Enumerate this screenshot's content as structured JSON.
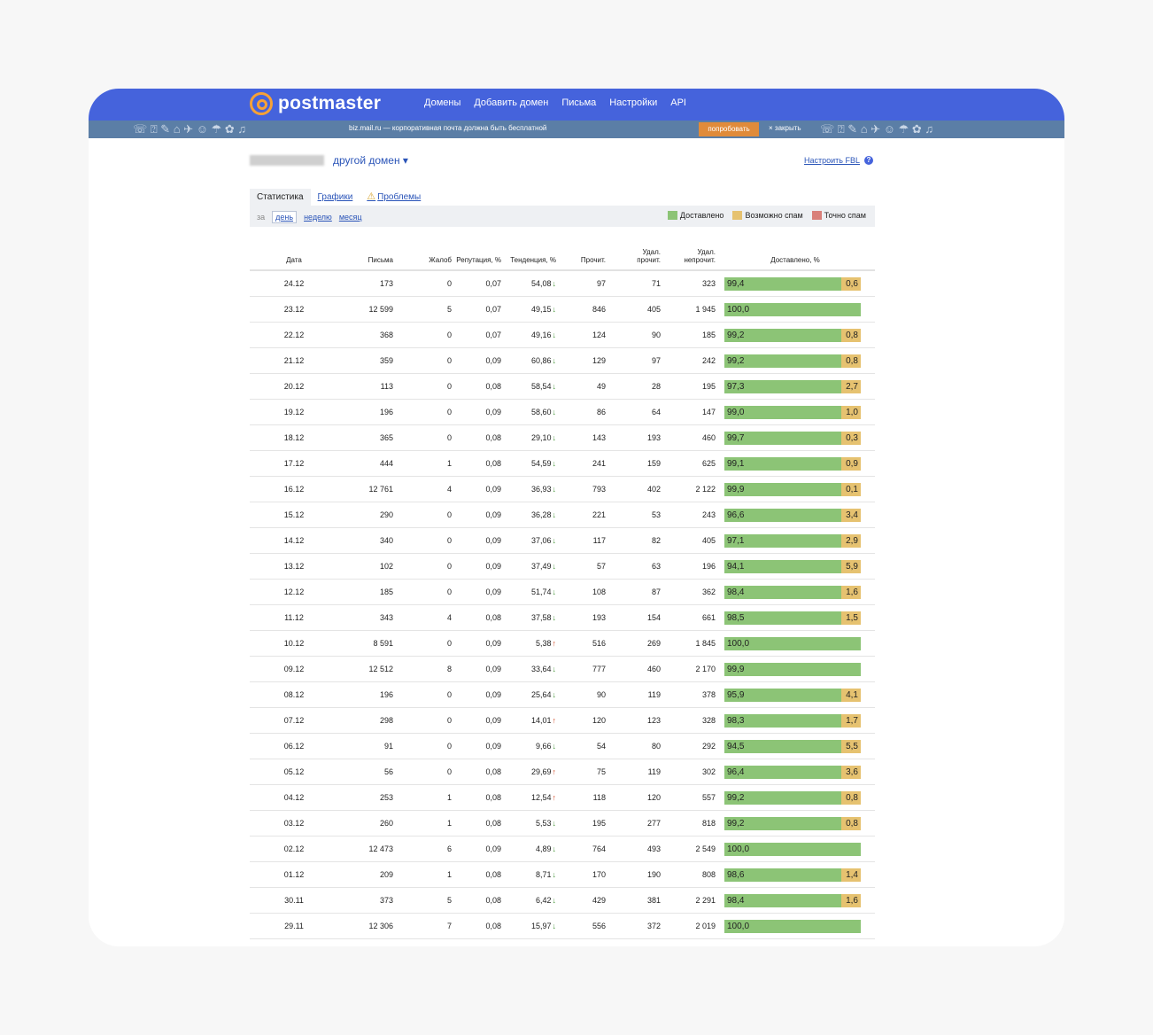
{
  "app": {
    "logo_text": "postmaster",
    "nav": [
      "Домены",
      "Добавить домен",
      "Письма",
      "Настройки",
      "API"
    ]
  },
  "ad": {
    "text": "biz.mail.ru — корпоративная почта должна быть бесплатной",
    "try_label": "попробовать",
    "close_label": "× закрыть",
    "doodles": "☏ ⍰ ✎ ⌂ ✈ ☺ ☂ ✿ ♫"
  },
  "domain": {
    "switch_label": "другой домен ▾",
    "fbl_label": "Настроить FBL",
    "help_glyph": "?"
  },
  "tabs": {
    "stats": "Статистика",
    "charts": "Графики",
    "problems": "Проблемы",
    "warn_glyph": "⚠"
  },
  "period": {
    "label": "за",
    "day": "день",
    "week": "неделю",
    "month": "месяц"
  },
  "legend": [
    {
      "label": "Доставлено",
      "color": "#8cc476"
    },
    {
      "label": "Возможно спам",
      "color": "#e6c270"
    },
    {
      "label": "Точно спам",
      "color": "#d9807a"
    }
  ],
  "columns": {
    "date": "Дата",
    "letters": "Письма",
    "complaints": "Жалоб",
    "reputation": "Репутация, %",
    "trend": "Тенденция, %",
    "read": "Прочит.",
    "del_read_1": "Удал.",
    "del_read_2": "прочит.",
    "del_unread_1": "Удал.",
    "del_unread_2": "непрочит.",
    "delivered": "Доставлено, %"
  },
  "rows": [
    {
      "date": "24.12",
      "letters": "173",
      "complaints": "0",
      "reputation": "0,07",
      "trend": "54,08",
      "dir": "down",
      "read": "97",
      "del_read": "71",
      "del_unread": "323",
      "delivered": "99,4",
      "spam": "0,6",
      "delivered_pct": 99.4
    },
    {
      "date": "23.12",
      "letters": "12 599",
      "complaints": "5",
      "reputation": "0,07",
      "trend": "49,15",
      "dir": "down",
      "read": "846",
      "del_read": "405",
      "del_unread": "1 945",
      "delivered": "100,0",
      "spam": "",
      "delivered_pct": 100
    },
    {
      "date": "22.12",
      "letters": "368",
      "complaints": "0",
      "reputation": "0,07",
      "trend": "49,16",
      "dir": "down",
      "read": "124",
      "del_read": "90",
      "del_unread": "185",
      "delivered": "99,2",
      "spam": "0,8",
      "delivered_pct": 99.2
    },
    {
      "date": "21.12",
      "letters": "359",
      "complaints": "0",
      "reputation": "0,09",
      "trend": "60,86",
      "dir": "down",
      "read": "129",
      "del_read": "97",
      "del_unread": "242",
      "delivered": "99,2",
      "spam": "0,8",
      "delivered_pct": 99.2
    },
    {
      "date": "20.12",
      "letters": "113",
      "complaints": "0",
      "reputation": "0,08",
      "trend": "58,54",
      "dir": "down",
      "read": "49",
      "del_read": "28",
      "del_unread": "195",
      "delivered": "97,3",
      "spam": "2,7",
      "delivered_pct": 97.3
    },
    {
      "date": "19.12",
      "letters": "196",
      "complaints": "0",
      "reputation": "0,09",
      "trend": "58,60",
      "dir": "down",
      "read": "86",
      "del_read": "64",
      "del_unread": "147",
      "delivered": "99,0",
      "spam": "1,0",
      "delivered_pct": 99.0
    },
    {
      "date": "18.12",
      "letters": "365",
      "complaints": "0",
      "reputation": "0,08",
      "trend": "29,10",
      "dir": "down",
      "read": "143",
      "del_read": "193",
      "del_unread": "460",
      "delivered": "99,7",
      "spam": "0,3",
      "delivered_pct": 99.7
    },
    {
      "date": "17.12",
      "letters": "444",
      "complaints": "1",
      "reputation": "0,08",
      "trend": "54,59",
      "dir": "down",
      "read": "241",
      "del_read": "159",
      "del_unread": "625",
      "delivered": "99,1",
      "spam": "0,9",
      "delivered_pct": 99.1
    },
    {
      "date": "16.12",
      "letters": "12 761",
      "complaints": "4",
      "reputation": "0,09",
      "trend": "36,93",
      "dir": "down",
      "read": "793",
      "del_read": "402",
      "del_unread": "2 122",
      "delivered": "99,9",
      "spam": "0,1",
      "delivered_pct": 99.9
    },
    {
      "date": "15.12",
      "letters": "290",
      "complaints": "0",
      "reputation": "0,09",
      "trend": "36,28",
      "dir": "down",
      "read": "221",
      "del_read": "53",
      "del_unread": "243",
      "delivered": "96,6",
      "spam": "3,4",
      "delivered_pct": 96.6
    },
    {
      "date": "14.12",
      "letters": "340",
      "complaints": "0",
      "reputation": "0,09",
      "trend": "37,06",
      "dir": "down",
      "read": "117",
      "del_read": "82",
      "del_unread": "405",
      "delivered": "97,1",
      "spam": "2,9",
      "delivered_pct": 97.1
    },
    {
      "date": "13.12",
      "letters": "102",
      "complaints": "0",
      "reputation": "0,09",
      "trend": "37,49",
      "dir": "down",
      "read": "57",
      "del_read": "63",
      "del_unread": "196",
      "delivered": "94,1",
      "spam": "5,9",
      "delivered_pct": 94.1
    },
    {
      "date": "12.12",
      "letters": "185",
      "complaints": "0",
      "reputation": "0,09",
      "trend": "51,74",
      "dir": "down",
      "read": "108",
      "del_read": "87",
      "del_unread": "362",
      "delivered": "98,4",
      "spam": "1,6",
      "delivered_pct": 98.4
    },
    {
      "date": "11.12",
      "letters": "343",
      "complaints": "4",
      "reputation": "0,08",
      "trend": "37,58",
      "dir": "down",
      "read": "193",
      "del_read": "154",
      "del_unread": "661",
      "delivered": "98,5",
      "spam": "1,5",
      "delivered_pct": 98.5
    },
    {
      "date": "10.12",
      "letters": "8 591",
      "complaints": "0",
      "reputation": "0,09",
      "trend": "5,38",
      "dir": "up",
      "read": "516",
      "del_read": "269",
      "del_unread": "1 845",
      "delivered": "100,0",
      "spam": "",
      "delivered_pct": 100
    },
    {
      "date": "09.12",
      "letters": "12 512",
      "complaints": "8",
      "reputation": "0,09",
      "trend": "33,64",
      "dir": "down",
      "read": "777",
      "del_read": "460",
      "del_unread": "2 170",
      "delivered": "99,9",
      "spam": "",
      "delivered_pct": 100
    },
    {
      "date": "08.12",
      "letters": "196",
      "complaints": "0",
      "reputation": "0,09",
      "trend": "25,64",
      "dir": "down",
      "read": "90",
      "del_read": "119",
      "del_unread": "378",
      "delivered": "95,9",
      "spam": "4,1",
      "delivered_pct": 95.9
    },
    {
      "date": "07.12",
      "letters": "298",
      "complaints": "0",
      "reputation": "0,09",
      "trend": "14,01",
      "dir": "up",
      "read": "120",
      "del_read": "123",
      "del_unread": "328",
      "delivered": "98,3",
      "spam": "1,7",
      "delivered_pct": 98.3
    },
    {
      "date": "06.12",
      "letters": "91",
      "complaints": "0",
      "reputation": "0,09",
      "trend": "9,66",
      "dir": "down",
      "read": "54",
      "del_read": "80",
      "del_unread": "292",
      "delivered": "94,5",
      "spam": "5,5",
      "delivered_pct": 94.5
    },
    {
      "date": "05.12",
      "letters": "56",
      "complaints": "0",
      "reputation": "0,08",
      "trend": "29,69",
      "dir": "up",
      "read": "75",
      "del_read": "119",
      "del_unread": "302",
      "delivered": "96,4",
      "spam": "3,6",
      "delivered_pct": 96.4
    },
    {
      "date": "04.12",
      "letters": "253",
      "complaints": "1",
      "reputation": "0,08",
      "trend": "12,54",
      "dir": "up",
      "read": "118",
      "del_read": "120",
      "del_unread": "557",
      "delivered": "99,2",
      "spam": "0,8",
      "delivered_pct": 99.2
    },
    {
      "date": "03.12",
      "letters": "260",
      "complaints": "1",
      "reputation": "0,08",
      "trend": "5,53",
      "dir": "down",
      "read": "195",
      "del_read": "277",
      "del_unread": "818",
      "delivered": "99,2",
      "spam": "0,8",
      "delivered_pct": 99.2
    },
    {
      "date": "02.12",
      "letters": "12 473",
      "complaints": "6",
      "reputation": "0,09",
      "trend": "4,89",
      "dir": "down",
      "read": "764",
      "del_read": "493",
      "del_unread": "2 549",
      "delivered": "100,0",
      "spam": "",
      "delivered_pct": 100
    },
    {
      "date": "01.12",
      "letters": "209",
      "complaints": "1",
      "reputation": "0,08",
      "trend": "8,71",
      "dir": "down",
      "read": "170",
      "del_read": "190",
      "del_unread": "808",
      "delivered": "98,6",
      "spam": "1,4",
      "delivered_pct": 98.6
    },
    {
      "date": "30.11",
      "letters": "373",
      "complaints": "5",
      "reputation": "0,08",
      "trend": "6,42",
      "dir": "down",
      "read": "429",
      "del_read": "381",
      "del_unread": "2 291",
      "delivered": "98,4",
      "spam": "1,6",
      "delivered_pct": 98.4
    },
    {
      "date": "29.11",
      "letters": "12 306",
      "complaints": "7",
      "reputation": "0,08",
      "trend": "15,97",
      "dir": "down",
      "read": "556",
      "del_read": "372",
      "del_unread": "2 019",
      "delivered": "100,0",
      "spam": "",
      "delivered_pct": 100
    }
  ]
}
